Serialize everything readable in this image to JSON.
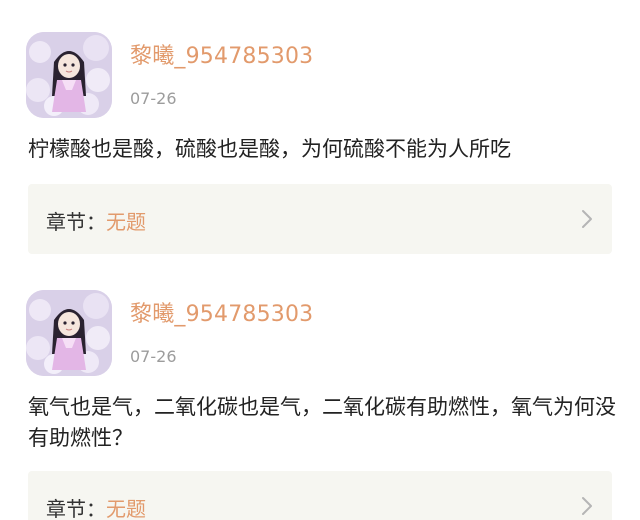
{
  "posts": [
    {
      "username": "黎曦_954785303",
      "date": "07-26",
      "content": "柠檬酸也是酸，硫酸也是酸，为何硫酸不能为人所吃",
      "chapter_label": "章节：",
      "chapter_value": "无题",
      "avatar_icon": "girl-avatar-icon"
    },
    {
      "username": "黎曦_954785303",
      "date": "07-26",
      "content": "氧气也是气，二氧化碳也是气，二氧化碳有助燃性，氧气为何没有助燃性？",
      "chapter_label": "章节：",
      "chapter_value": "无题",
      "avatar_icon": "girl-avatar-icon"
    }
  ],
  "colors": {
    "username": "#e29a6c",
    "chapter_value": "#e29a6c",
    "date": "#9c9c9c",
    "chapter_bg": "#f6f6f1"
  },
  "icons": {
    "chapter_arrow": "chevron-right-icon"
  }
}
